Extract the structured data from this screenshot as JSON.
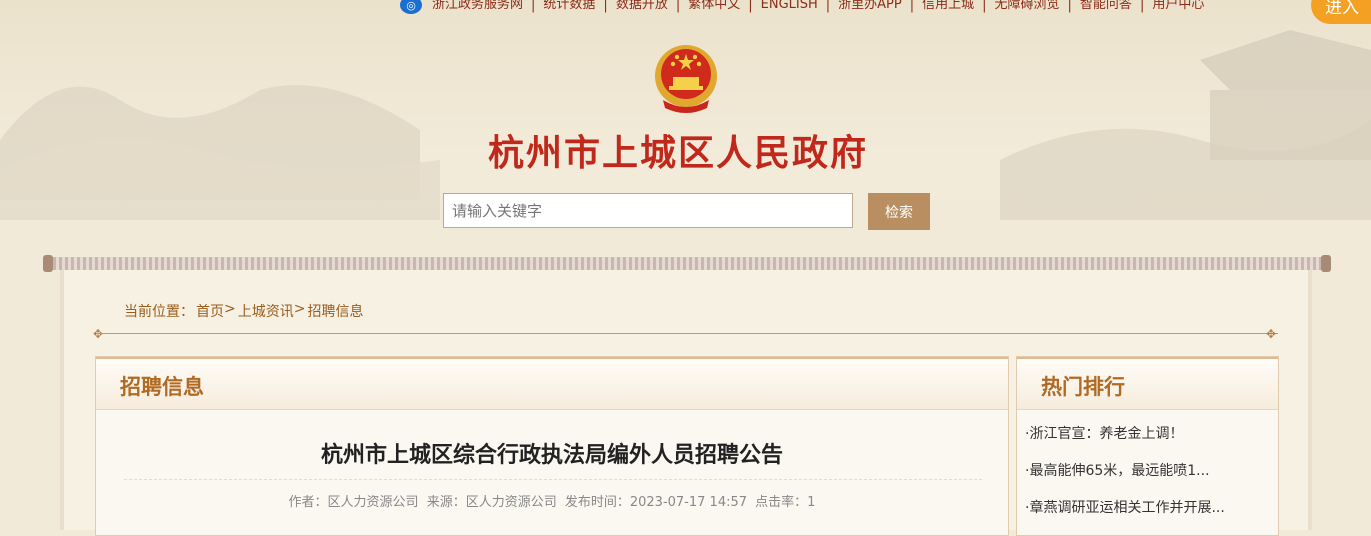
{
  "nav": {
    "items": [
      "浙江政务服务网",
      "统计数据",
      "数据开放",
      "繁体中文",
      "ENGLISH",
      "浙里办APP",
      "信用上城",
      "无障碍浏览",
      "智能问答",
      "用户中心"
    ],
    "enter": "进入"
  },
  "site_title": "杭州市上城区人民政府",
  "search": {
    "placeholder": "请输入关键字",
    "button": "检索"
  },
  "breadcrumb": {
    "prefix": "当前位置：",
    "items": [
      "首页",
      "上城资讯",
      "招聘信息"
    ],
    "sep": ">"
  },
  "main_panel": {
    "title": "招聘信息",
    "article_title": "杭州市上城区综合行政执法局编外人员招聘公告",
    "meta": {
      "author": "作者：区人力资源公司",
      "source": "来源：区人力资源公司",
      "published": "发布时间：2023-07-17 14:57",
      "clicks": "点击率：1"
    }
  },
  "side_panel": {
    "title": "热门排行",
    "items": [
      "·浙江官宣：养老金上调！",
      "·最高能伸65米，最远能喷1...",
      "·章燕调研亚运相关工作并开展..."
    ]
  },
  "colors": {
    "title_red": "#c0281c",
    "accent_brown": "#b98f62",
    "enter_orange": "#f4a023"
  }
}
